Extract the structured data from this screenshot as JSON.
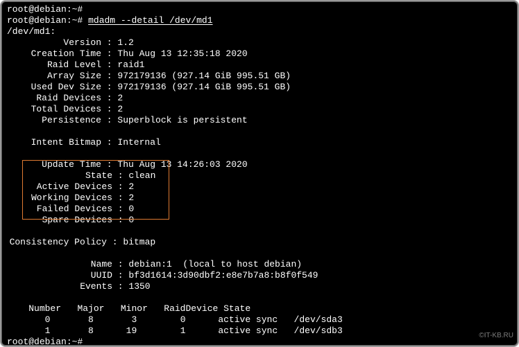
{
  "prompt": {
    "user": "root",
    "host": "debian",
    "cwd": "~",
    "symbol": "#"
  },
  "command": "mdadm --detail /dev/md1",
  "device": "/dev/md1:",
  "info": {
    "Version": {
      "label": "Version",
      "value": "1.2"
    },
    "CreationTime": {
      "label": "Creation Time",
      "value": "Thu Aug 13 12:35:18 2020"
    },
    "RaidLevel": {
      "label": "Raid Level",
      "value": "raid1"
    },
    "ArraySize": {
      "label": "Array Size",
      "value": "972179136 (927.14 GiB 995.51 GB)"
    },
    "UsedDevSize": {
      "label": "Used Dev Size",
      "value": "972179136 (927.14 GiB 995.51 GB)"
    },
    "RaidDevices": {
      "label": "Raid Devices",
      "value": "2"
    },
    "TotalDevices": {
      "label": "Total Devices",
      "value": "2"
    },
    "Persistence": {
      "label": "Persistence",
      "value": "Superblock is persistent"
    },
    "IntentBitmap": {
      "label": "Intent Bitmap",
      "value": "Internal"
    },
    "UpdateTime": {
      "label": "Update Time",
      "value": "Thu Aug 13 14:26:03 2020"
    },
    "State": {
      "label": "State",
      "value": "clean"
    },
    "ActiveDevices": {
      "label": "Active Devices",
      "value": "2"
    },
    "WorkingDevices": {
      "label": "Working Devices",
      "value": "2"
    },
    "FailedDevices": {
      "label": "Failed Devices",
      "value": "0"
    },
    "SpareDevices": {
      "label": "Spare Devices",
      "value": "0"
    },
    "ConsistencyPolicy": {
      "label": "Consistency Policy",
      "value": "bitmap"
    },
    "Name": {
      "label": "Name",
      "value": "debian:1  (local to host debian)"
    },
    "UUID": {
      "label": "UUID",
      "value": "bf3d1614:3d90dbf2:e8e7b7a8:b8f0f549"
    },
    "Events": {
      "label": "Events",
      "value": "1350"
    }
  },
  "table": {
    "headers": {
      "number": "Number",
      "major": "Major",
      "minor": "Minor",
      "raiddev": "RaidDevice",
      "state": "State"
    },
    "rows": [
      {
        "number": "0",
        "major": "8",
        "minor": "3",
        "raiddev": "0",
        "state": "active sync",
        "dev": "/dev/sda3"
      },
      {
        "number": "1",
        "major": "8",
        "minor": "19",
        "raiddev": "1",
        "state": "active sync",
        "dev": "/dev/sdb3"
      }
    ]
  },
  "watermark": "©IT-KB.RU"
}
